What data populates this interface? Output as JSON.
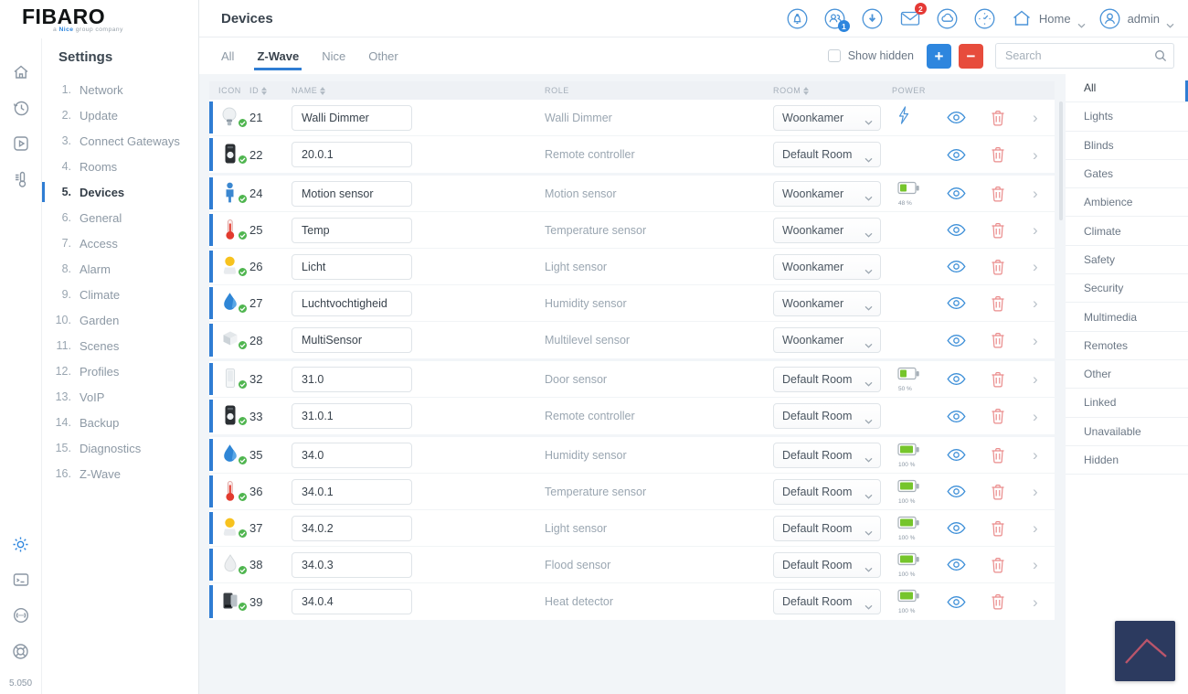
{
  "brand": {
    "name": "FIBARO",
    "tagline_prefix": "a ",
    "tagline_bold": "Nice",
    "tagline_suffix": " group company",
    "version": "5.050"
  },
  "header": {
    "title": "Devices",
    "users_badge": "1",
    "mail_badge": "2",
    "home_label": "Home",
    "user_label": "admin"
  },
  "sidebar": {
    "title": "Settings",
    "active_index": 4,
    "items": [
      {
        "num": "1.",
        "label": "Network"
      },
      {
        "num": "2.",
        "label": "Update"
      },
      {
        "num": "3.",
        "label": "Connect Gateways"
      },
      {
        "num": "4.",
        "label": "Rooms"
      },
      {
        "num": "5.",
        "label": "Devices"
      },
      {
        "num": "6.",
        "label": "General"
      },
      {
        "num": "7.",
        "label": "Access"
      },
      {
        "num": "8.",
        "label": "Alarm"
      },
      {
        "num": "9.",
        "label": "Climate"
      },
      {
        "num": "10.",
        "label": "Garden"
      },
      {
        "num": "11.",
        "label": "Scenes"
      },
      {
        "num": "12.",
        "label": "Profiles"
      },
      {
        "num": "13.",
        "label": "VoIP"
      },
      {
        "num": "14.",
        "label": "Backup"
      },
      {
        "num": "15.",
        "label": "Diagnostics"
      },
      {
        "num": "16.",
        "label": "Z-Wave"
      }
    ]
  },
  "tabs": [
    {
      "label": "All",
      "active": false
    },
    {
      "label": "Z-Wave",
      "active": true
    },
    {
      "label": "Nice",
      "active": false
    },
    {
      "label": "Other",
      "active": false
    }
  ],
  "controls": {
    "show_hidden_label": "Show hidden",
    "add_label": "+",
    "remove_label": "−",
    "search_placeholder": "Search"
  },
  "table": {
    "headers": [
      {
        "label": "ICON",
        "sortable": false
      },
      {
        "label": "ID",
        "sortable": true
      },
      {
        "label": "NAME",
        "sortable": true
      },
      {
        "label": "ROLE",
        "sortable": false
      },
      {
        "label": "ROOM",
        "sortable": true
      },
      {
        "label": "POWER",
        "sortable": false
      }
    ],
    "rows": [
      {
        "icon": "dimmer-bulb",
        "id": "21",
        "name": "Walli Dimmer",
        "role": "Walli Dimmer",
        "room": "Woonkamer",
        "power": {
          "type": "mains"
        },
        "group_end": false
      },
      {
        "icon": "remote",
        "id": "22",
        "name": "20.0.1",
        "role": "Remote controller",
        "room": "Default Room",
        "power": {
          "type": "none"
        },
        "group_end": true
      },
      {
        "icon": "motion",
        "id": "24",
        "name": "Motion sensor",
        "role": "Motion sensor",
        "room": "Woonkamer",
        "power": {
          "type": "battery",
          "level": 48,
          "label": "48 %"
        },
        "group_end": false
      },
      {
        "icon": "thermometer",
        "id": "25",
        "name": "Temp",
        "role": "Temperature sensor",
        "room": "Woonkamer",
        "power": {
          "type": "none"
        },
        "group_end": false
      },
      {
        "icon": "light",
        "id": "26",
        "name": "Licht",
        "role": "Light sensor",
        "room": "Woonkamer",
        "power": {
          "type": "none"
        },
        "group_end": false
      },
      {
        "icon": "humidity",
        "id": "27",
        "name": "Luchtvochtigheid",
        "role": "Humidity sensor",
        "room": "Woonkamer",
        "power": {
          "type": "none"
        },
        "group_end": false
      },
      {
        "icon": "multisensor",
        "id": "28",
        "name": "MultiSensor",
        "role": "Multilevel sensor",
        "room": "Woonkamer",
        "power": {
          "type": "none"
        },
        "group_end": true
      },
      {
        "icon": "door",
        "id": "32",
        "name": "31.0",
        "role": "Door sensor",
        "room": "Default Room",
        "power": {
          "type": "battery",
          "level": 50,
          "label": "50 %"
        },
        "group_end": false
      },
      {
        "icon": "remote",
        "id": "33",
        "name": "31.0.1",
        "role": "Remote controller",
        "room": "Default Room",
        "power": {
          "type": "none"
        },
        "group_end": true
      },
      {
        "icon": "humidity",
        "id": "35",
        "name": "34.0",
        "role": "Humidity sensor",
        "room": "Default Room",
        "power": {
          "type": "battery",
          "level": 100,
          "label": "100 %"
        },
        "group_end": false
      },
      {
        "icon": "thermometer",
        "id": "36",
        "name": "34.0.1",
        "role": "Temperature sensor",
        "room": "Default Room",
        "power": {
          "type": "battery",
          "level": 100,
          "label": "100 %"
        },
        "group_end": false
      },
      {
        "icon": "light",
        "id": "37",
        "name": "34.0.2",
        "role": "Light sensor",
        "room": "Default Room",
        "power": {
          "type": "battery",
          "level": 100,
          "label": "100 %"
        },
        "group_end": false
      },
      {
        "icon": "flood",
        "id": "38",
        "name": "34.0.3",
        "role": "Flood sensor",
        "room": "Default Room",
        "power": {
          "type": "battery",
          "level": 100,
          "label": "100 %"
        },
        "group_end": false
      },
      {
        "icon": "heat",
        "id": "39",
        "name": "34.0.4",
        "role": "Heat detector",
        "room": "Default Room",
        "power": {
          "type": "battery",
          "level": 100,
          "label": "100 %"
        },
        "group_end": true
      }
    ]
  },
  "categories": {
    "active_index": 0,
    "items": [
      "All",
      "Lights",
      "Blinds",
      "Gates",
      "Ambience",
      "Climate",
      "Safety",
      "Security",
      "Multimedia",
      "Remotes",
      "Other",
      "Linked",
      "Unavailable",
      "Hidden"
    ]
  },
  "colors": {
    "accent_blue": "#2f7dd3",
    "icon_blue": "#4a93d8",
    "danger_red": "#e74c3c",
    "battery_green": "#76c52c",
    "check_green": "#4fb54f",
    "bg_gray": "#f2f5f8"
  }
}
